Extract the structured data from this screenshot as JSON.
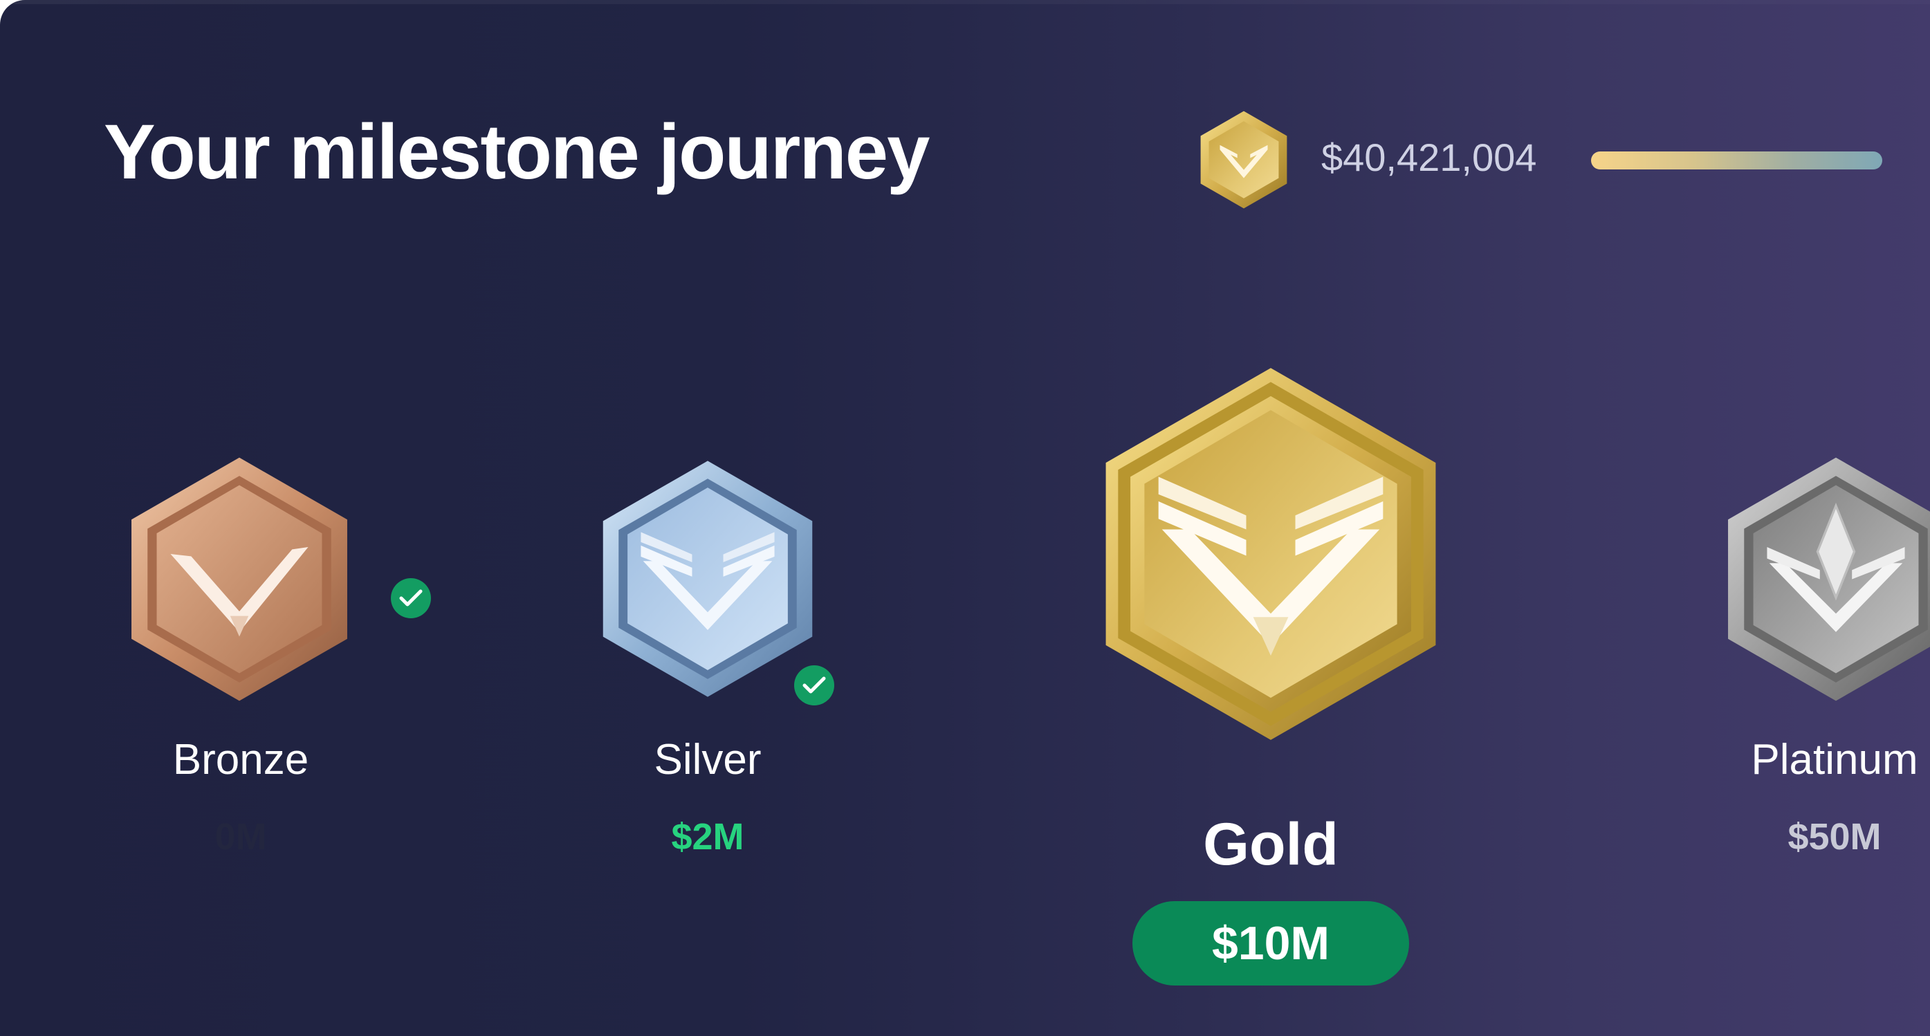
{
  "header": {
    "title": "Your milestone journey",
    "current_badge_icon": "gold-badge-icon",
    "balance": "$40,421,004",
    "progress_fraction": 0.81
  },
  "tiers": [
    {
      "name": "Bronze",
      "amount": "0M",
      "achieved": true,
      "current": false,
      "icon": "bronze-badge-icon",
      "amount_color": "#23263f"
    },
    {
      "name": "Silver",
      "amount": "$2M",
      "achieved": true,
      "current": false,
      "icon": "silver-badge-icon",
      "amount_color": "#27d37f"
    },
    {
      "name": "Gold",
      "amount": "$10M",
      "achieved": false,
      "current": true,
      "icon": "gold-badge-icon",
      "amount_color": "#ffffff"
    },
    {
      "name": "Platinum",
      "amount": "$50M",
      "achieved": false,
      "current": false,
      "icon": "platinum-badge-icon",
      "amount_color": "#c8c9d6"
    }
  ],
  "colors": {
    "panel_left": "#1f2240",
    "panel_right": "#433b6b",
    "check_green": "#139d62",
    "pill_green": "#0a8a57",
    "progress_start": "#f6d489",
    "progress_end": "#7fa8b6"
  }
}
